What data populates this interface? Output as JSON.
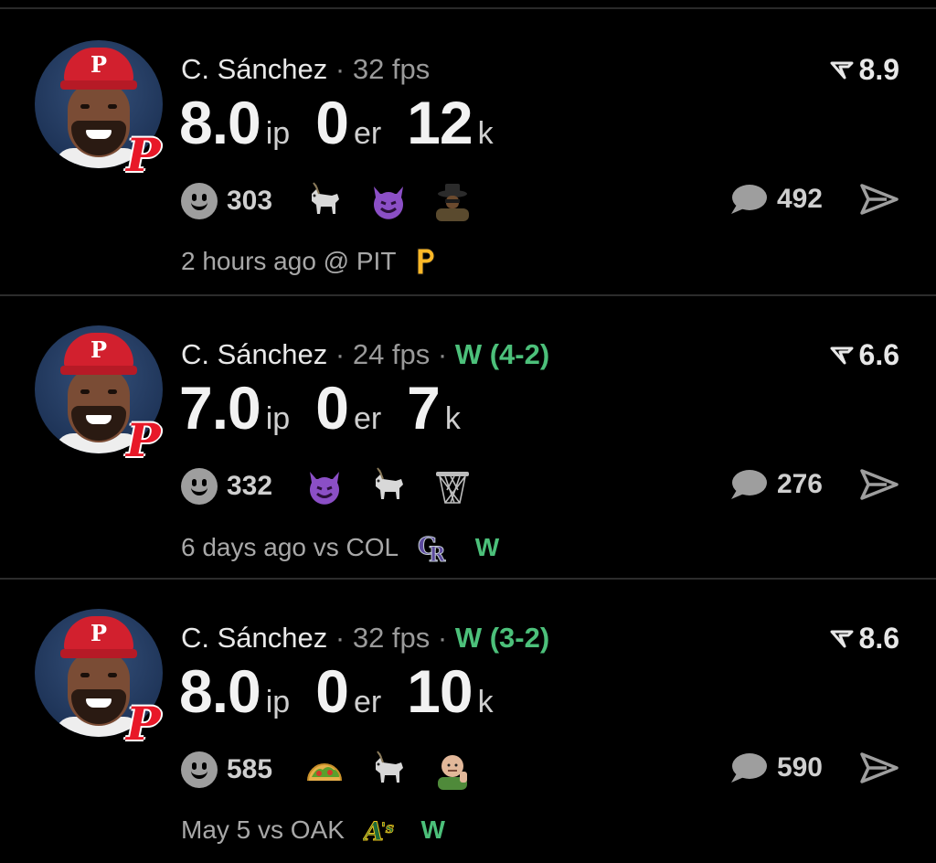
{
  "feed": [
    {
      "player": "C. Sánchez",
      "fps": "32 fps",
      "record": "",
      "score": "8.9",
      "ip": "8.0",
      "ip_label": "ip",
      "er": "0",
      "er_label": "er",
      "k": "12",
      "k_label": "k",
      "reaction_count": "303",
      "reactions": [
        "goat",
        "smiling-devil",
        "person-in-hat"
      ],
      "comment_count": "492",
      "time_text": "2 hours ago @ PIT",
      "opponent": "PIT",
      "result": ""
    },
    {
      "player": "C. Sánchez",
      "fps": "24 fps",
      "record": "W (4-2)",
      "score": "6.6",
      "ip": "7.0",
      "ip_label": "ip",
      "er": "0",
      "er_label": "er",
      "k": "7",
      "k_label": "k",
      "reaction_count": "332",
      "reactions": [
        "smiling-devil",
        "goat",
        "basketball-net"
      ],
      "comment_count": "276",
      "time_text": "6 days ago vs COL",
      "opponent": "COL",
      "result": "W"
    },
    {
      "player": "C. Sánchez",
      "fps": "32 fps",
      "record": "W (3-2)",
      "score": "8.6",
      "ip": "8.0",
      "ip_label": "ip",
      "er": "0",
      "er_label": "er",
      "k": "10",
      "k_label": "k",
      "reaction_count": "585",
      "reactions": [
        "taco",
        "goat",
        "success-kid"
      ],
      "comment_count": "590",
      "time_text": "May 5 vs OAK",
      "opponent": "OAK",
      "result": "W"
    }
  ],
  "colors": {
    "background": "#000000",
    "win_green": "#4cc07a",
    "phillies_red": "#e81828",
    "pirates_gold": "#fdb827",
    "rockies_purple": "#5c4a9e",
    "athletics_green": "#1f6b3a"
  }
}
